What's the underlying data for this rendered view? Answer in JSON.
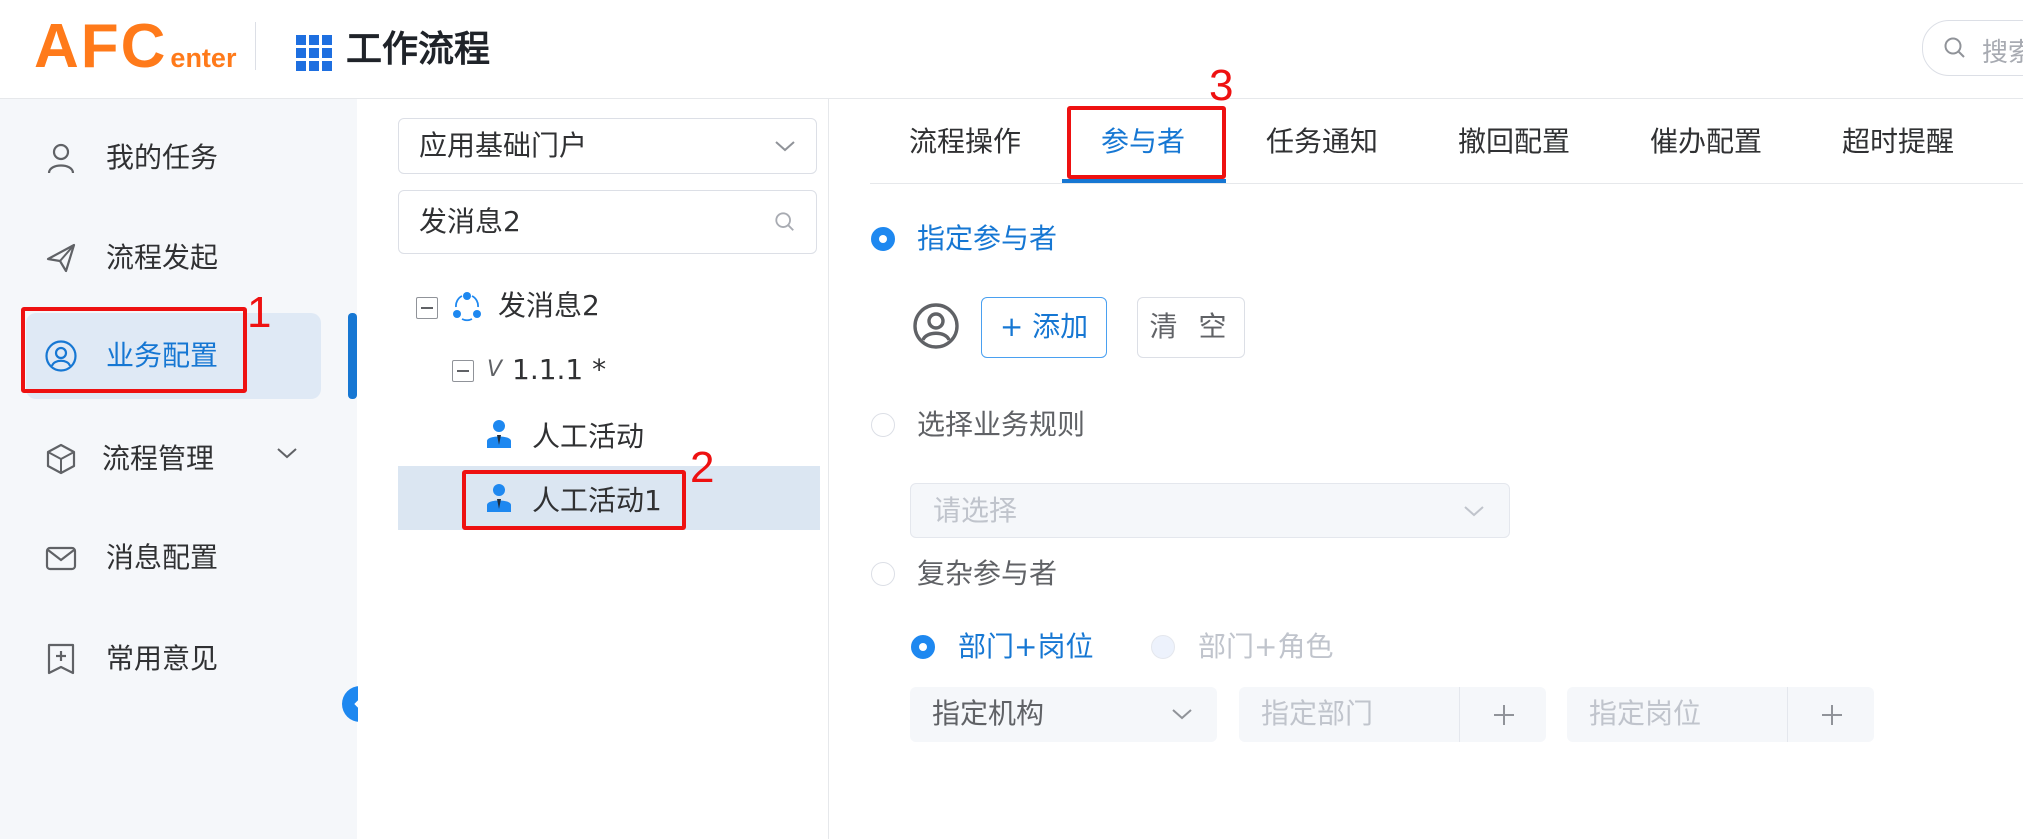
{
  "header": {
    "logo_main": "AFC",
    "logo_sub": "enter",
    "app_title": "工作流程",
    "search_placeholder": "搜索",
    "brand_color": "#ff7a1a",
    "accent_color": "#1677d3"
  },
  "sidebar": {
    "items": [
      {
        "label": "我的任务",
        "icon": "user-icon"
      },
      {
        "label": "流程发起",
        "icon": "rocket-icon"
      },
      {
        "label": "业务配置",
        "icon": "user-circle-icon",
        "active": true
      },
      {
        "label": "流程管理",
        "icon": "cube-icon",
        "expandable": true
      },
      {
        "label": "消息配置",
        "icon": "mail-icon"
      },
      {
        "label": "常用意见",
        "icon": "note-add-icon"
      }
    ]
  },
  "tree_panel": {
    "app_select": "应用基础门户",
    "search_value": "发消息2",
    "nodes": [
      {
        "label": "发消息2",
        "icon": "process-icon"
      },
      {
        "label": "1.1.1 *",
        "prefix": "V"
      },
      {
        "label": "人工活动",
        "icon": "person-activity-icon"
      },
      {
        "label": "人工活动1",
        "icon": "person-activity-icon",
        "selected": true
      }
    ]
  },
  "config": {
    "tabs": [
      "流程操作",
      "参与者",
      "任务通知",
      "撤回配置",
      "催办配置",
      "超时提醒"
    ],
    "active_tab": "参与者",
    "options": {
      "specified": "指定参与者",
      "business_rule": "选择业务规则",
      "complex": "复杂参与者"
    },
    "add_button": "+ 添加",
    "clear_button": "清 空",
    "rule_select_placeholder": "请选择",
    "complex_modes": {
      "dept_post": "部门+岗位",
      "dept_role": "部门+角色"
    },
    "org_select": "指定机构",
    "dept_placeholder": "指定部门",
    "post_placeholder": "指定岗位"
  },
  "annotations": {
    "labels": [
      "1",
      "2",
      "3"
    ],
    "color": "#ee1111"
  }
}
